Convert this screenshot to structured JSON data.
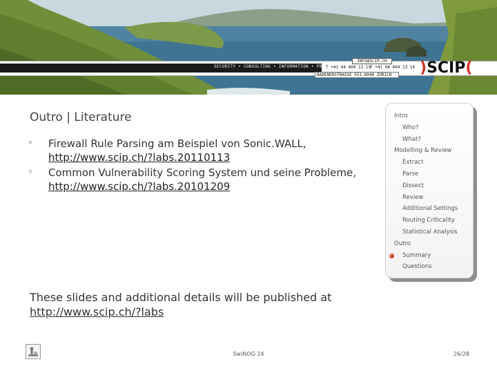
{
  "header": {
    "email": "INFO@SCIP.CH",
    "services": "SECURITY • CONSULTING • INFORMATION • PROCESS",
    "phone": "T +41 44 404 13 13",
    "fax": "F +41 44 404 13 14",
    "address": "BADENERSTRASSE 551  8048 ZÜRICH",
    "logo_left": ")",
    "logo_text": "SCIP",
    "logo_right": "("
  },
  "slide": {
    "title": "Outro | Literature",
    "bullets": [
      {
        "marker": "◦",
        "text": "Firewall Rule Parsing am Beispiel von Sonic.WALL, ",
        "link": "http://www.scip.ch/?labs.20110113"
      },
      {
        "marker": "◦",
        "text": "Common Vulnerability Scoring System und seine Probleme, ",
        "link": "http://www.scip.ch/?labs.20101209"
      }
    ],
    "note_text": "These slides and additional details will be published at ",
    "note_link": "http://www.scip.ch/?labs"
  },
  "nav": {
    "items": [
      {
        "label": "Intro",
        "level": 0,
        "current": false
      },
      {
        "label": "Who?",
        "level": 1,
        "current": false
      },
      {
        "label": "What?",
        "level": 1,
        "current": false
      },
      {
        "label": "Modelling & Review",
        "level": 0,
        "current": false
      },
      {
        "label": "Extract",
        "level": 1,
        "current": false
      },
      {
        "label": "Parse",
        "level": 1,
        "current": false
      },
      {
        "label": "Dissect",
        "level": 1,
        "current": false
      },
      {
        "label": "Review",
        "level": 1,
        "current": false
      },
      {
        "label": "Additional Settings",
        "level": 1,
        "current": false
      },
      {
        "label": "Routing Criticality",
        "level": 1,
        "current": false
      },
      {
        "label": "Statistical Analysis",
        "level": 1,
        "current": false
      },
      {
        "label": "Outro",
        "level": 0,
        "current": false
      },
      {
        "label": "Summary",
        "level": 1,
        "current": true
      },
      {
        "label": "Questions",
        "level": 1,
        "current": false
      }
    ],
    "current_color": "#d2302a"
  },
  "footer": {
    "event": "SwiNOG 24",
    "page": "26/28"
  }
}
